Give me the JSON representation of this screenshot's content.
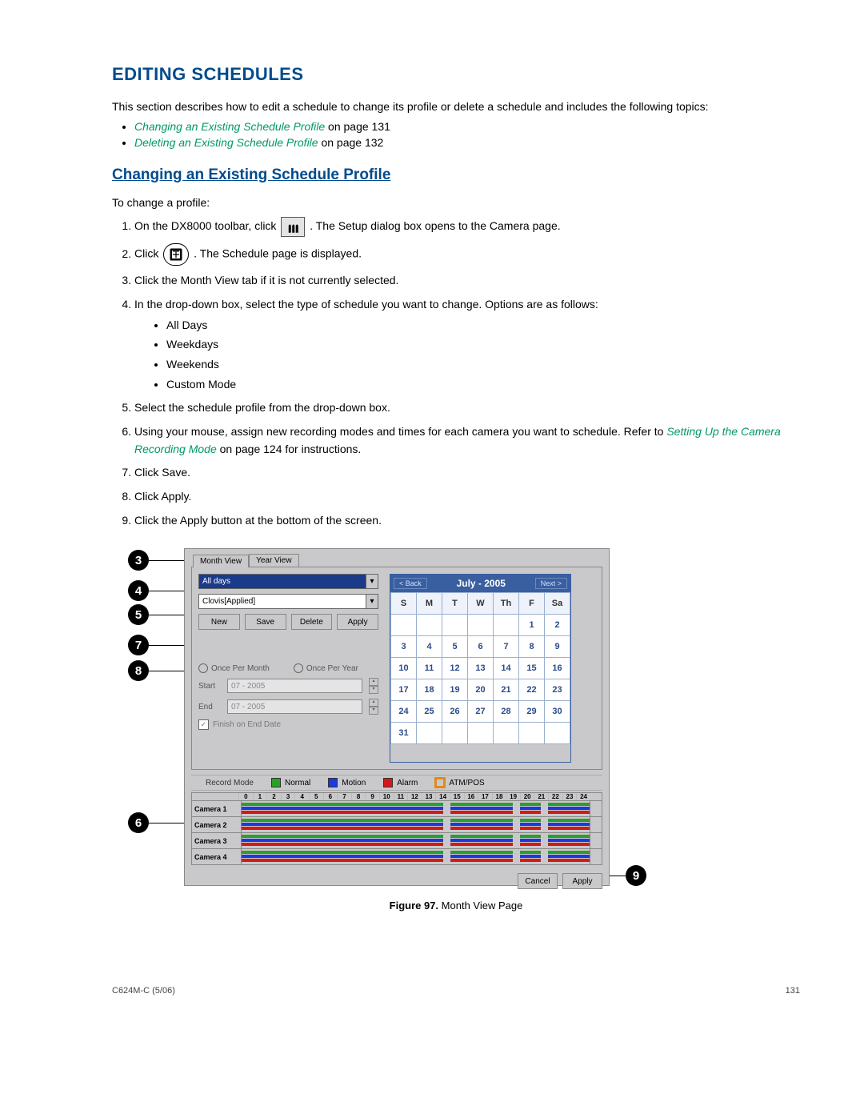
{
  "heading": "EDITING SCHEDULES",
  "intro": "This section describes how to edit a schedule to change its profile or delete a schedule and includes the following topics:",
  "links": [
    {
      "label": "Changing an Existing Schedule Profile",
      "suffix": " on page 131"
    },
    {
      "label": "Deleting an Existing Schedule Profile",
      "suffix": " on page 132"
    }
  ],
  "subheading": "Changing an Existing Schedule Profile",
  "lead": "To change a profile:",
  "steps": {
    "s1a": "On the DX8000 toolbar, click ",
    "s1b": ". The Setup dialog box opens to the Camera page.",
    "s2a": "Click ",
    "s2b": " . The Schedule page is displayed.",
    "s3": "Click the Month View tab if it is not currently selected.",
    "s4": "In the drop-down box, select the type of schedule you want to change. Options are as follows:",
    "s4opts": [
      "All Days",
      "Weekdays",
      "Weekends",
      "Custom Mode"
    ],
    "s5": "Select the schedule profile from the drop-down box.",
    "s6a": "Using your mouse, assign new recording modes and times for each camera you want to schedule. Refer to ",
    "s6link": "Setting Up the Camera Recording Mode",
    "s6b": " on page 124 for instructions.",
    "s7": "Click Save.",
    "s8": "Click Apply.",
    "s9": "Click the Apply button at the bottom of the screen."
  },
  "dialog": {
    "tabs": [
      "Month View",
      "Year View"
    ],
    "dropdown1": "All days",
    "dropdown2": "Clovis[Applied]",
    "buttons": {
      "new": "New",
      "save": "Save",
      "delete": "Delete",
      "apply": "Apply"
    },
    "radio1": "Once Per Month",
    "radio2": "Once Per Year",
    "start": "Start",
    "end": "End",
    "date": "07 - 2005",
    "finish": "Finish on End Date",
    "calendar": {
      "back": "< Back",
      "next": "Next >",
      "title": "July - 2005",
      "dow": [
        "S",
        "M",
        "T",
        "W",
        "Th",
        "F",
        "Sa"
      ],
      "weeks": [
        [
          "",
          "",
          "",
          "",
          "",
          "1",
          "2"
        ],
        [
          "3",
          "4",
          "5",
          "6",
          "7",
          "8",
          "9"
        ],
        [
          "10",
          "11",
          "12",
          "13",
          "14",
          "15",
          "16"
        ],
        [
          "17",
          "18",
          "19",
          "20",
          "21",
          "22",
          "23"
        ],
        [
          "24",
          "25",
          "26",
          "27",
          "28",
          "29",
          "30"
        ],
        [
          "31",
          "",
          "",
          "",
          "",
          "",
          ""
        ]
      ]
    },
    "legend": {
      "label": "Record Mode",
      "normal": "Normal",
      "motion": "Motion",
      "alarm": "Alarm",
      "atm": "ATM/POS"
    },
    "hours": [
      "0",
      "1",
      "2",
      "3",
      "4",
      "5",
      "6",
      "7",
      "8",
      "9",
      "10",
      "11",
      "12",
      "13",
      "14",
      "15",
      "16",
      "17",
      "18",
      "19",
      "20",
      "21",
      "22",
      "23",
      "24"
    ],
    "cameras": [
      "Camera 1",
      "Camera 2",
      "Camera 3",
      "Camera 4"
    ],
    "footer": {
      "cancel": "Cancel",
      "apply": "Apply"
    }
  },
  "callouts": {
    "c3": "3",
    "c4": "4",
    "c5": "5",
    "c6": "6",
    "c7": "7",
    "c8": "8",
    "c9": "9"
  },
  "figure": {
    "num": "Figure 97.",
    "title": "  Month View Page"
  },
  "footer": {
    "left": "C624M-C (5/06)",
    "right": "131"
  }
}
